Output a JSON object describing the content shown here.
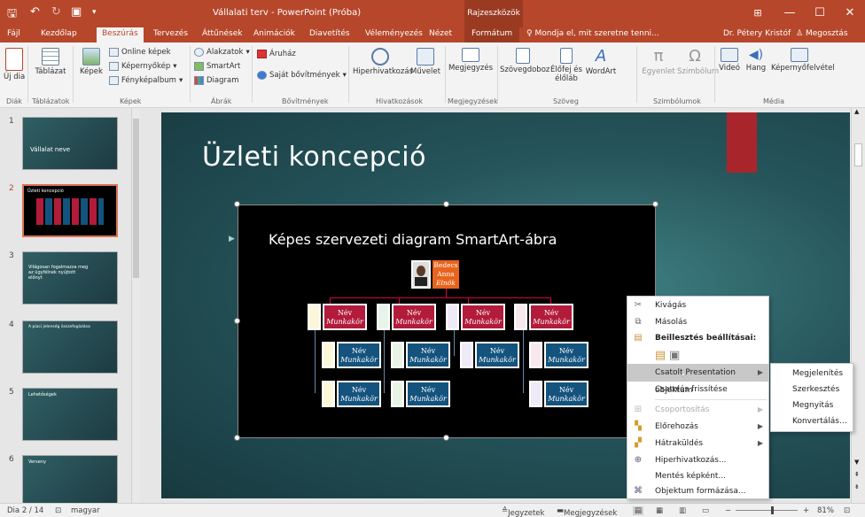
{
  "titlebar": {
    "title": "Vállalati terv - PowerPoint (Próba)",
    "context_tools": "Rajzeszközök"
  },
  "tabs": {
    "file": "Fájl",
    "home": "Kezdőlap",
    "insert": "Beszúrás",
    "design": "Tervezés",
    "transitions": "Áttűnések",
    "animations": "Animációk",
    "slideshow": "Diavetítés",
    "review": "Véleményezés",
    "view": "Nézet",
    "format": "Formátum",
    "tellme": "Mondja el, mit szeretne tenni...",
    "user": "Dr. Pétery Kristóf",
    "share": "Megosztás"
  },
  "ribbon": {
    "new_slide": "Új dia",
    "table": "Táblázat",
    "pictures": "Képek",
    "online_pictures": "Online képek",
    "screenshot": "Képernyőkép",
    "photo_album": "Fényképalbum",
    "shapes": "Alakzatok",
    "smartart": "SmartArt",
    "chart": "Diagram",
    "store": "Áruház",
    "my_addins": "Saját bővítmények",
    "hyperlink": "Hiperhivatkozás",
    "action": "Művelet",
    "comment": "Megjegyzés",
    "textbox": "Szövegdoboz",
    "header_footer_1": "Élőfej és",
    "header_footer_2": "élőláb",
    "wordart": "WordArt",
    "equation": "Egyenlet",
    "symbol": "Szimbólum",
    "video": "Videó",
    "audio": "Hang",
    "screen_recording": "Képernyőfelvétel",
    "groups": {
      "slides": "Diák",
      "tables": "Táblázatok",
      "images": "Képek",
      "illustrations": "Ábrák",
      "addins": "Bővítmények",
      "links": "Hivatkozások",
      "comments": "Megjegyzések",
      "text": "Szöveg",
      "symbols": "Szimbólumok",
      "media": "Média"
    }
  },
  "thumbnails": [
    {
      "num": "1",
      "text": "Vállalat neve"
    },
    {
      "num": "2",
      "text": "Üzleti koncepció"
    },
    {
      "num": "3",
      "text": "Világosan fogalmazza meg az ügyfélnek nyújtott előnyt"
    },
    {
      "num": "4",
      "text": "A piaci jelenség összefoglalása"
    },
    {
      "num": "5",
      "text": "Lehetőségek"
    },
    {
      "num": "6",
      "text": "Verseny"
    }
  ],
  "slide": {
    "title": "Üzleti koncepció",
    "smartart_title": "Képes szervezeti diagram SmartArt-ábra",
    "top_box": {
      "line1": "Bedecs",
      "line2": "Anna",
      "line3": "Elnök"
    },
    "box_name": "Név",
    "box_role": "Munkakör"
  },
  "context_menu": {
    "cut": "Kivágás",
    "copy": "Másolás",
    "paste_options": "Beillesztés beállításai:",
    "linked_object": "Csatolt Presentation objektum",
    "refresh_link": "Csatolás frissítése",
    "group": "Csoportosítás",
    "bring_forward": "Előrehozás",
    "send_backward": "Hátraküldés",
    "hyperlink": "Hiperhivatkozás...",
    "save_as_picture": "Mentés képként...",
    "format_object": "Objektum formázása..."
  },
  "submenu": {
    "show": "Megjelenítés",
    "edit": "Szerkesztés",
    "open": "Megnyitás",
    "convert": "Konvertálás..."
  },
  "status": {
    "slide": "Dia 2 / 14",
    "language": "magyar",
    "notes": "Jegyzetek",
    "comments": "Megjegyzések",
    "zoom": "81%"
  },
  "colors": {
    "accent": "#b7472a",
    "slide_bg": "#25545a",
    "org_red": "#b21b3a",
    "org_blue": "#14537e"
  }
}
